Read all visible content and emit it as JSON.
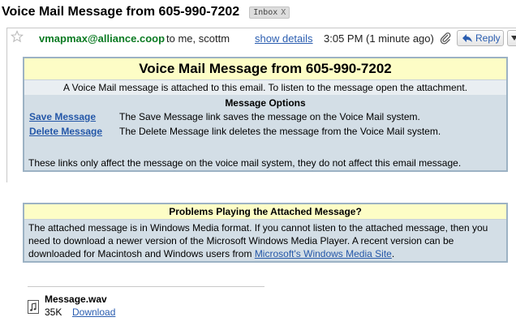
{
  "subject": "Voice Mail Message from 605-990-7202",
  "label_chip": {
    "text": "Inbox",
    "remove": "X"
  },
  "message": {
    "sender": "vmapmax@alliance.coop",
    "to": "to me, scottm",
    "show_details": "show details",
    "time": "3:05 PM (1 minute ago)",
    "reply_label": "Reply"
  },
  "voicemail_box": {
    "title": "Voice Mail Message from 605-990-7202",
    "intro": "A Voice Mail message is attached to this email. To listen to the message open the attachment.",
    "options_heading": "Message Options",
    "options": [
      {
        "link": "Save Message",
        "desc": "The Save Message link saves the message on the Voice Mail system."
      },
      {
        "link": "Delete Message",
        "desc": "The Delete Message link deletes the message from the Voice Mail system."
      }
    ],
    "note": "These links only affect the message on the voice mail system, they do not affect this email message."
  },
  "problems_box": {
    "title": "Problems Playing the Attached Message?",
    "body": "The attached message is in Windows Media format. If you cannot listen to the attached message, then you need to download a newer version of the Microsoft Windows Media Player. A recent version can be downloaded for Macintosh and Windows users from ",
    "link": "Microsoft's Windows Media Site",
    "end": "."
  },
  "attachment": {
    "name": "Message.wav",
    "size": "35K",
    "download": "Download"
  },
  "colors": {
    "sender": "#0b7a22",
    "link": "#2a5db0",
    "box_bg": "#d3dee6",
    "box_title_bg": "#fdfdc6",
    "box_border": "#9cb2c4"
  },
  "icons": [
    "star-icon",
    "paperclip-icon",
    "reply-arrow-icon",
    "dropdown-arrow-icon",
    "audio-file-icon"
  ]
}
